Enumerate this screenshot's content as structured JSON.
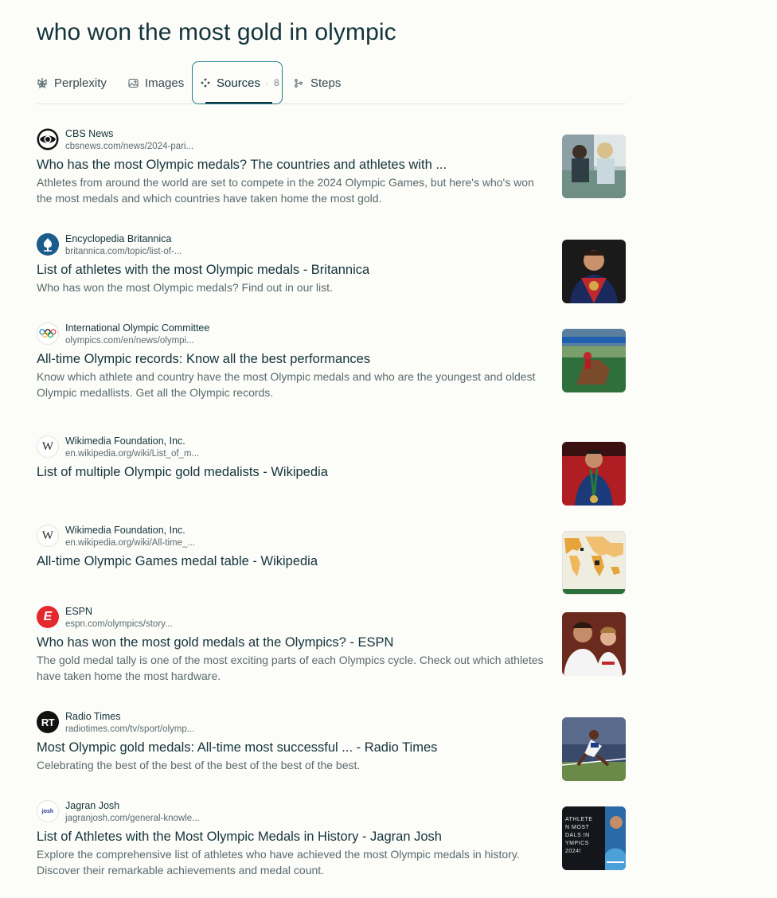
{
  "query": "who won the most gold in olympic",
  "tabs": [
    {
      "label": "Perplexity",
      "icon": "perplexity-icon"
    },
    {
      "label": "Images",
      "icon": "image-icon"
    },
    {
      "label": "Sources",
      "icon": "sources-icon",
      "count": "8",
      "active": true
    },
    {
      "label": "Steps",
      "icon": "steps-icon"
    }
  ],
  "results": [
    {
      "source": "CBS News",
      "url": "cbsnews.com/news/2024-pari...",
      "title": "Who has the most Olympic medals? The countries and athletes with ...",
      "snippet": "Athletes from around the world are set to compete in the 2024 Olympic Games, but here's who's won the most medals and which countries have taken home the most gold.",
      "icon": "cbs-eye-icon"
    },
    {
      "source": "Encyclopedia Britannica",
      "url": "britannica.com/topic/list-of-...",
      "title": "List of athletes with the most Olympic medals - Britannica",
      "snippet": "Who has won the most Olympic medals? Find out in our list.",
      "icon": "britannica-thistle-icon"
    },
    {
      "source": "International Olympic Committee",
      "url": "olympics.com/en/news/olympi...",
      "title": "All-time Olympic records: Know all the best performances",
      "snippet": "Know which athlete and country have the most Olympic medals and who are the youngest and oldest Olympic medallists. Get all the Olympic records.",
      "icon": "olympic-rings-icon"
    },
    {
      "source": "Wikimedia Foundation, Inc.",
      "url": "en.wikipedia.org/wiki/List_of_m...",
      "title": "List of multiple Olympic gold medalists - Wikipedia",
      "snippet": "",
      "icon": "wikipedia-w-icon"
    },
    {
      "source": "Wikimedia Foundation, Inc.",
      "url": "en.wikipedia.org/wiki/All-time_...",
      "title": "All-time Olympic Games medal table - Wikipedia",
      "snippet": "",
      "icon": "wikipedia-w-icon"
    },
    {
      "source": "ESPN",
      "url": "espn.com/olympics/story...",
      "title": "Who has won the most gold medals at the Olympics? - ESPN",
      "snippet": "The gold medal tally is one of the most exciting parts of each Olympics cycle. Check out which athletes have taken home the most hardware.",
      "icon": "espn-e-icon"
    },
    {
      "source": "Radio Times",
      "url": "radiotimes.com/tv/sport/olymp...",
      "title": "Most Olympic gold medals: All-time most successful ... - Radio Times",
      "snippet": "Celebrating the best of the best of the best of the best of the best.",
      "icon": "radio-times-rt-icon"
    },
    {
      "source": "Jagran Josh",
      "url": "jagranjosh.com/general-knowle...",
      "title": "List of Athletes with the Most Olympic Medals in History - Jagran Josh",
      "snippet": "Explore the comprehensive list of athletes who have achieved the most Olympic medals in history. Discover their remarkable achievements and medal count.",
      "icon": "jagran-josh-icon"
    }
  ],
  "favicon_text": {
    "wikipedia": "W",
    "espn": "E",
    "radiotimes": "RT",
    "josh": "josh"
  },
  "thumb_text": {
    "jagran": "ATHLETE\nN MOST\nDALS IN\nYMPICS\n2024!"
  },
  "colors": {
    "accent": "#20808d",
    "text": "#13343b",
    "muted": "#5a6a6e",
    "background": "#fcfcf9",
    "espn_red": "#e4282e"
  }
}
